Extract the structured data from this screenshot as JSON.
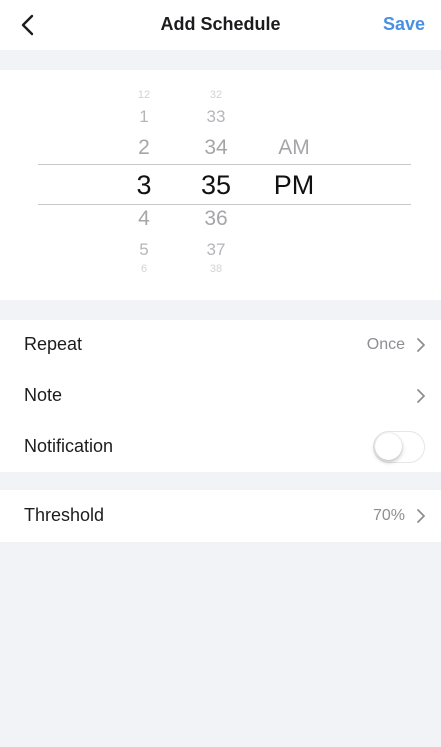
{
  "header": {
    "title": "Add Schedule",
    "save_label": "Save",
    "back_icon": "chevron-left-icon",
    "accent_color": "#4a90e2"
  },
  "time_picker": {
    "hours": [
      "12",
      "1",
      "2",
      "3",
      "4",
      "5",
      "6"
    ],
    "minutes": [
      "32",
      "33",
      "34",
      "35",
      "36",
      "37",
      "38"
    ],
    "periods": [
      "AM",
      "PM"
    ],
    "selected": {
      "hour": "3",
      "minute": "35",
      "period": "PM"
    }
  },
  "settings": {
    "repeat": {
      "label": "Repeat",
      "value": "Once"
    },
    "note": {
      "label": "Note",
      "value": ""
    },
    "notification": {
      "label": "Notification",
      "enabled": false
    },
    "threshold": {
      "label": "Threshold",
      "value": "70%"
    }
  }
}
